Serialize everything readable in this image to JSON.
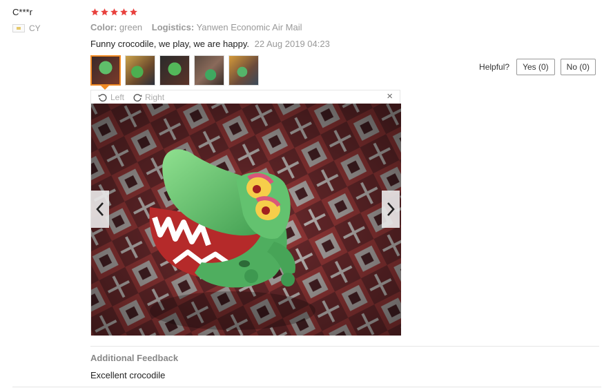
{
  "reviewer": {
    "name": "C***r",
    "country_code": "CY"
  },
  "review": {
    "rating": 5,
    "color_label": "Color:",
    "color_value": "green",
    "logistics_label": "Logistics:",
    "logistics_value": "Yanwen Economic Air Mail",
    "text": "Funny crocodile, we play, we are happy.",
    "date": "22 Aug 2019 04:23"
  },
  "viewer": {
    "rotate_left_label": "Left",
    "rotate_right_label": "Right",
    "close_symbol": "×",
    "thumbnail_count": 5,
    "active_thumbnail": 1
  },
  "helpful": {
    "label": "Helpful?",
    "yes_label": "Yes (0)",
    "no_label": "No (0)"
  },
  "additional_feedback": {
    "title": "Additional Feedback",
    "text": "Excellent crocodile"
  },
  "colors": {
    "star": "#e8413e",
    "active_thumb_border": "#f08a24"
  }
}
